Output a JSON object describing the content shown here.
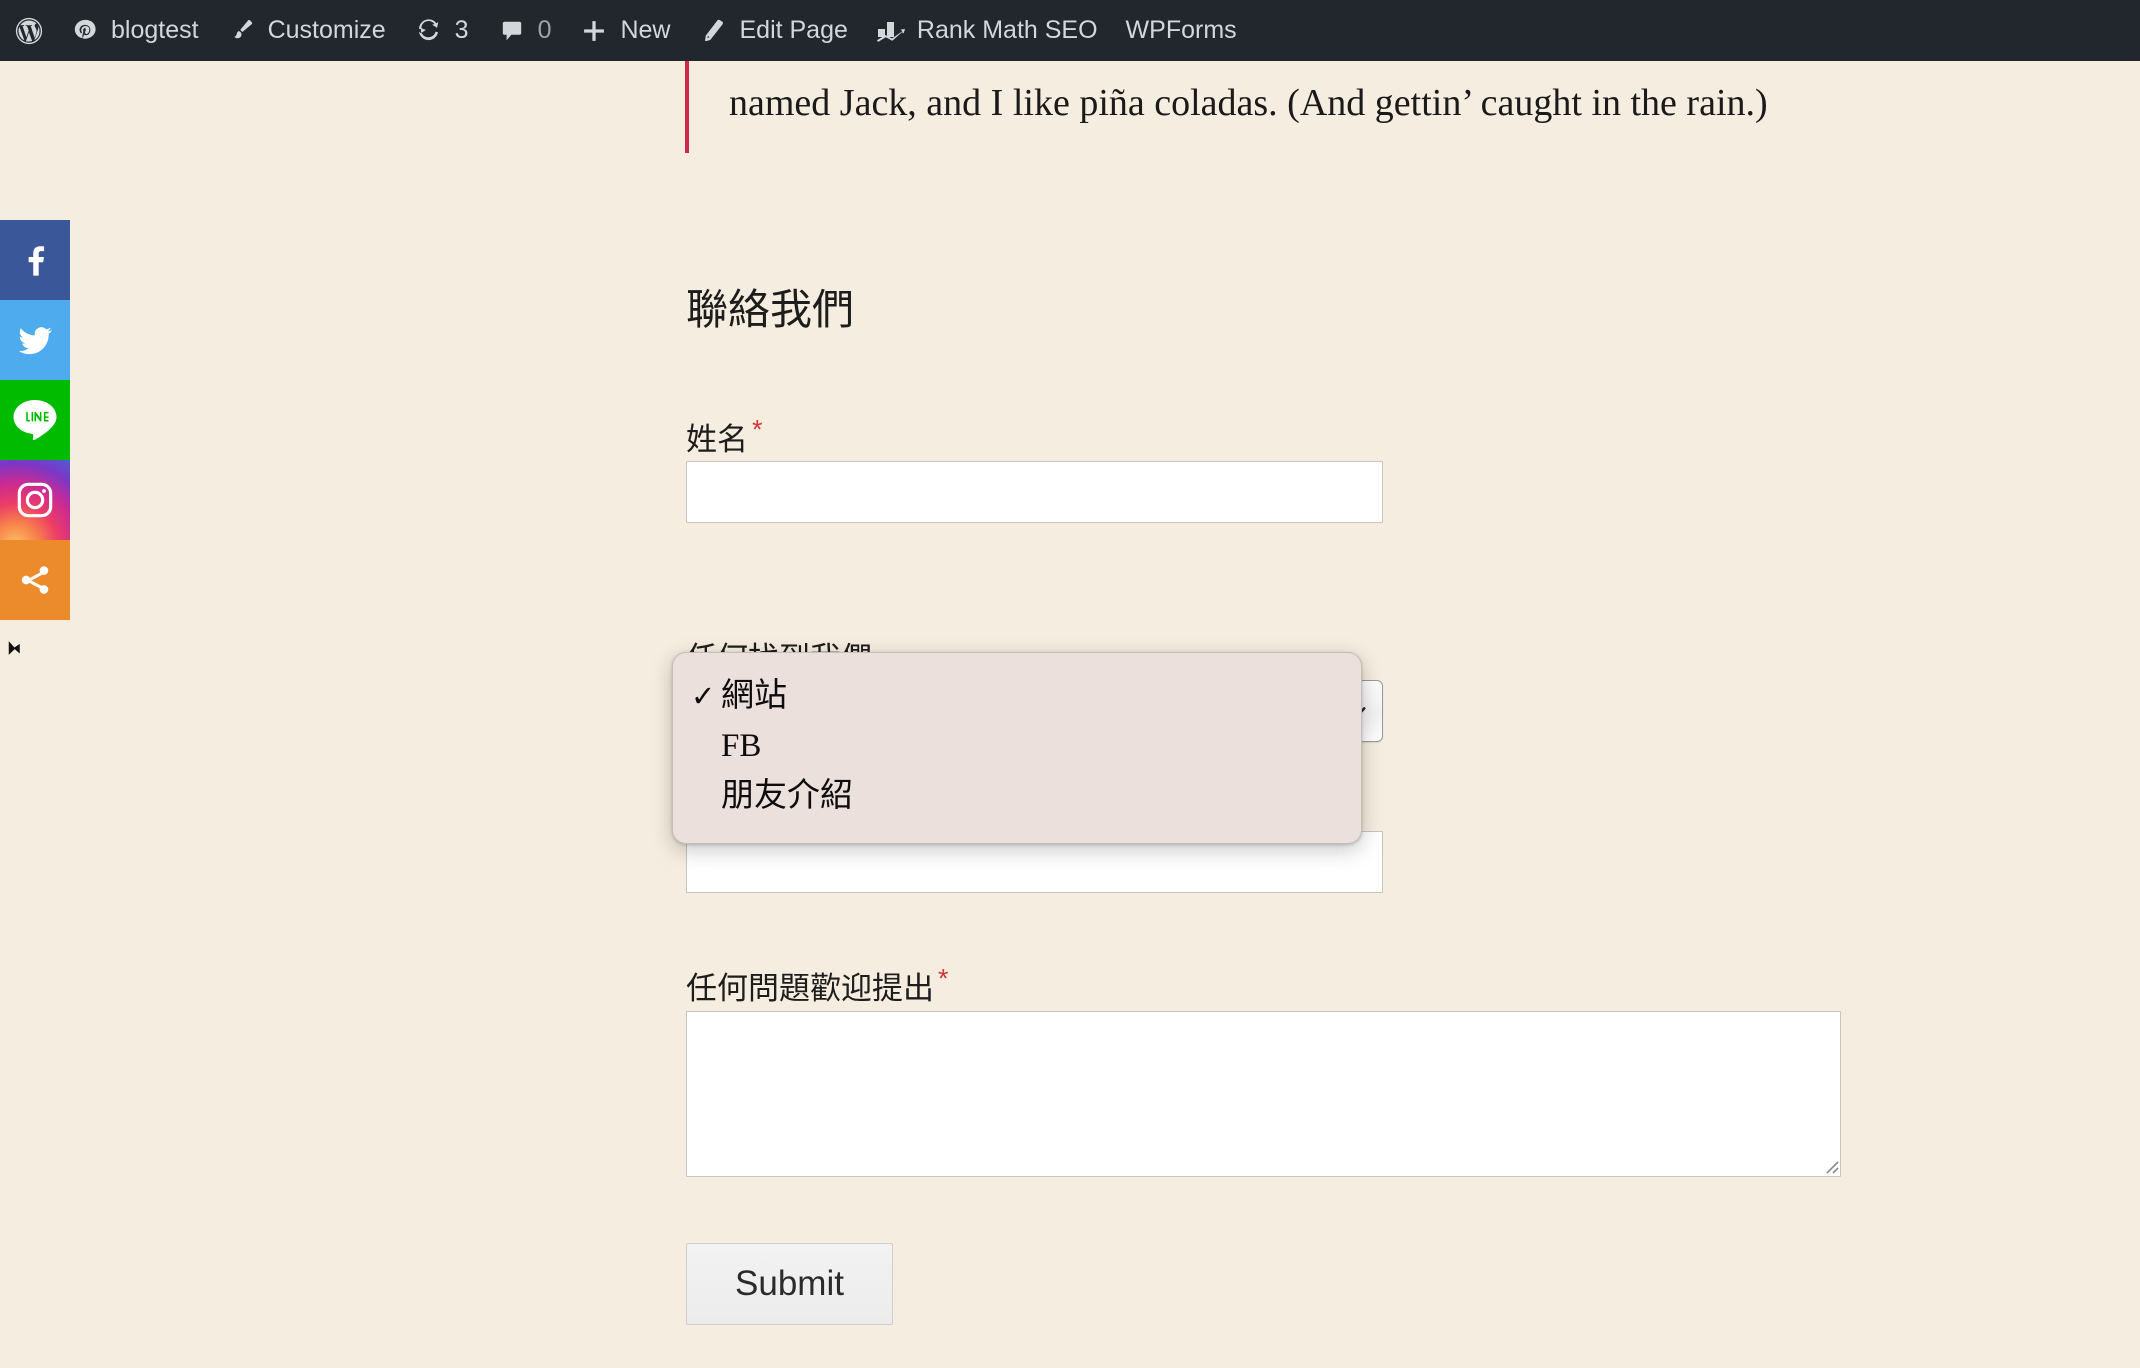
{
  "admin_bar": {
    "items": [
      {
        "id": "wp-logo",
        "icon": "wordpress-logo-icon",
        "label": ""
      },
      {
        "id": "site-name",
        "icon": "dashboard-icon",
        "label": "blogtest"
      },
      {
        "id": "customize",
        "icon": "paintbrush-icon",
        "label": "Customize"
      },
      {
        "id": "updates",
        "icon": "updates-icon",
        "label": "3"
      },
      {
        "id": "comments",
        "icon": "comment-bubble-icon",
        "label": "0"
      },
      {
        "id": "new",
        "icon": "plus-icon",
        "label": "New"
      },
      {
        "id": "edit-page",
        "icon": "pencil-icon",
        "label": "Edit Page"
      },
      {
        "id": "rank-math",
        "icon": "rank-math-chart-icon",
        "label": "Rank Math SEO"
      },
      {
        "id": "wpforms",
        "icon": "",
        "label": "WPForms"
      }
    ]
  },
  "social_bar": {
    "buttons": [
      {
        "id": "facebook",
        "icon": "facebook-icon",
        "color": "#3a579a",
        "label": "Facebook"
      },
      {
        "id": "twitter",
        "icon": "twitter-icon",
        "color": "#4eacee",
        "label": "Twitter"
      },
      {
        "id": "line",
        "icon": "line-icon",
        "color": "#00bb00",
        "label": "LINE"
      },
      {
        "id": "instagram",
        "icon": "instagram-icon",
        "color": "#cc2a92",
        "label": "Instagram"
      },
      {
        "id": "share",
        "icon": "share-nodes-icon",
        "color": "#ec8b2b",
        "label": "Share"
      }
    ],
    "collapse_icon": "collapse-left-arrow-icon"
  },
  "content": {
    "blockquote": "named Jack, and I like piña coladas. (And gettin’ caught in the rain.)",
    "blockquote_border_color": "#cc2a4d"
  },
  "form": {
    "title": "聯絡我們",
    "fields": {
      "name": {
        "label": "姓名",
        "required_marker": "*",
        "value": "",
        "placeholder": ""
      },
      "source": {
        "label": "任何找到我們",
        "required_marker": "",
        "selected": "網站",
        "options": [
          {
            "label": "網站",
            "checked": true,
            "check_glyph": "✓"
          },
          {
            "label": "FB",
            "checked": false,
            "check_glyph": ""
          },
          {
            "label": "朋友介紹",
            "checked": false,
            "check_glyph": ""
          }
        ],
        "chevron_icon": "chevron-down-icon"
      },
      "occluded": {
        "label": "",
        "value": "",
        "placeholder": ""
      },
      "message": {
        "label": "任何問題歡迎提出",
        "required_marker": "*",
        "value": "",
        "placeholder": ""
      }
    },
    "submit_label": "Submit"
  },
  "theme": {
    "page_background": "#f5eddf",
    "admin_bar_background": "#22262d",
    "admin_bar_text": "#d4d7da",
    "required_color": "#d63638",
    "popup_background": "#ece0dd",
    "input_background": "#ffffff",
    "input_border": "#c6c6c0"
  }
}
